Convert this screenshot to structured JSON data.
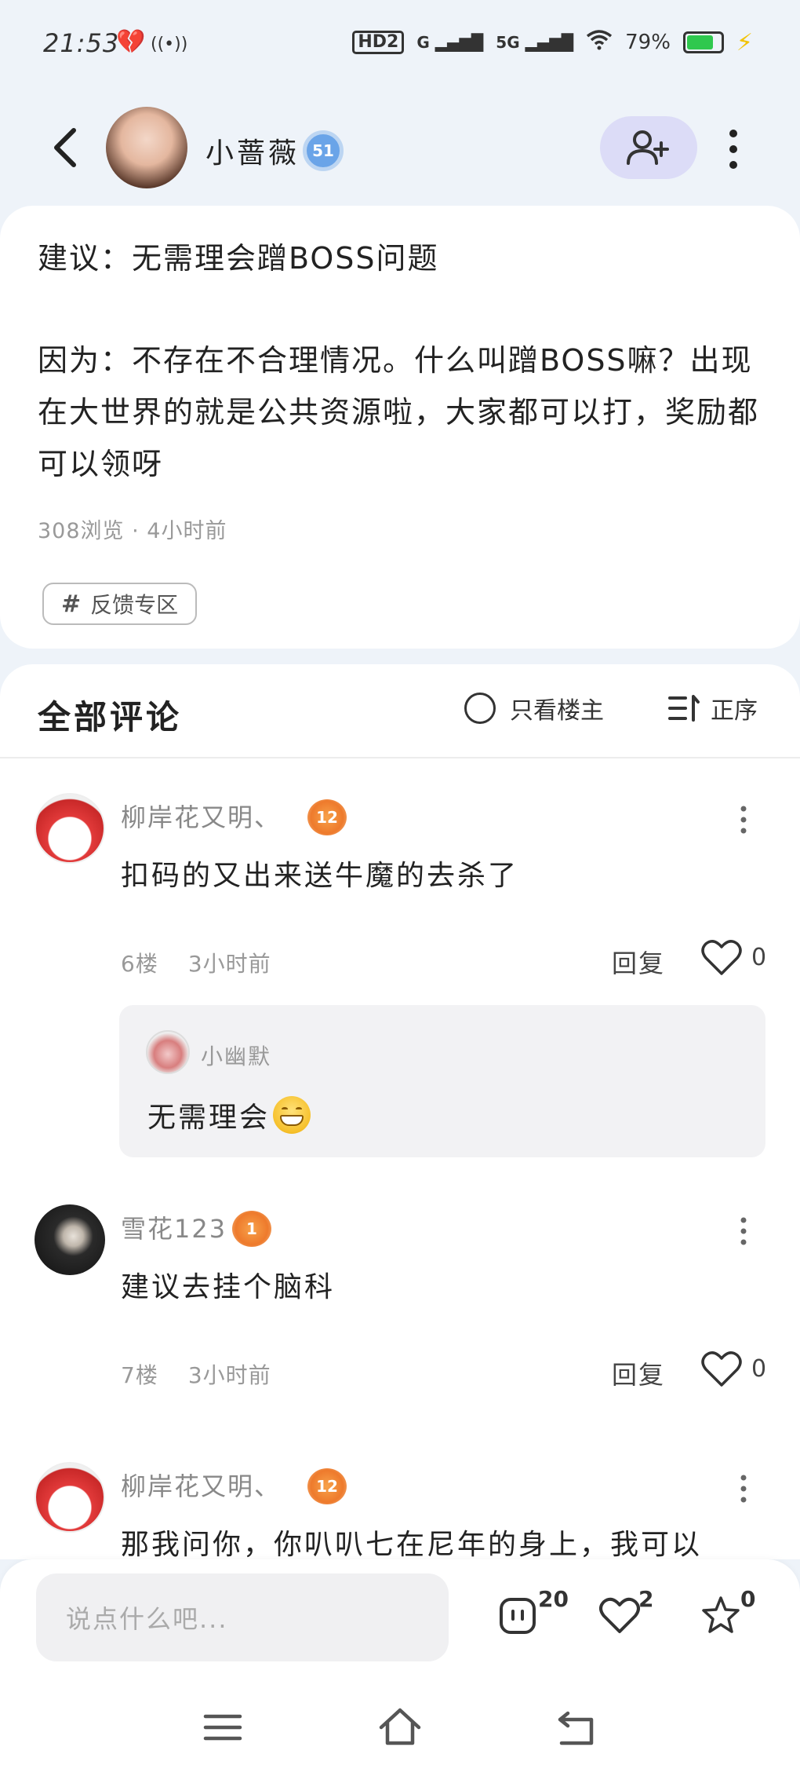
{
  "status_bar": {
    "time": "21:53",
    "hd_label": "HD2",
    "signal1_label": "G",
    "signal2_label": "5G",
    "battery": "79%",
    "battery_level": 0.79
  },
  "header": {
    "author_name": "小蔷薇",
    "author_level": "51"
  },
  "post": {
    "title": "建议：无需理会蹭BOSS问题",
    "body": "因为：不存在不合理情况。什么叫蹭BOSS嘛？出现在大世界的就是公共资源啦，大家都可以打，奖励都可以领呀",
    "meta": "308浏览 · 4小时前",
    "tag_symbol": "#",
    "tag": "反馈专区"
  },
  "comments_section": {
    "title": "全部评论",
    "only_owner_label": "只看楼主",
    "sort_label": "正序"
  },
  "comments": [
    {
      "name": "柳岸花又明、",
      "level": "12",
      "text": "扣码的又出来送牛魔的去杀了",
      "floor": "6楼",
      "time": "3小时前",
      "reply_label": "回复",
      "likes": "0",
      "sub_reply": {
        "name": "小幽默",
        "text": "无需理会"
      }
    },
    {
      "name": "雪花123",
      "level": "1",
      "text": "建议去挂个脑科",
      "floor": "7楼",
      "time": "3小时前",
      "reply_label": "回复",
      "likes": "0"
    },
    {
      "name": "柳岸花又明、",
      "level": "12",
      "text": "那我问你，你叭叭七在尼年的身上，我可以"
    }
  ],
  "bottom_bar": {
    "input_placeholder": "说点什么吧...",
    "comment_count": "20",
    "like_count": "2",
    "star_count": "0"
  },
  "colors": {
    "page_bg": "#eef3f9",
    "follow_btn_bg": "#dcdcf7",
    "badge_blue": "#6aa4e8",
    "badge_orange": "#ee7a2c"
  }
}
